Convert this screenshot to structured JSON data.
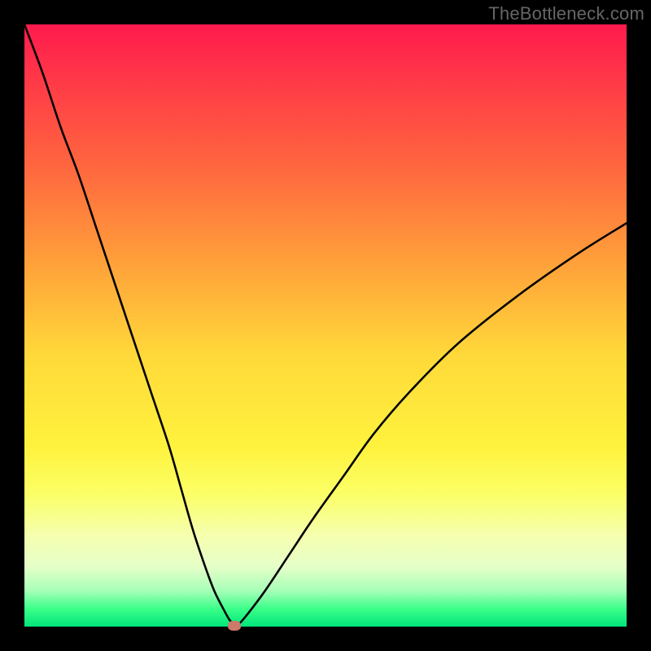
{
  "watermark": "TheBottleneck.com",
  "chart_data": {
    "type": "line",
    "title": "",
    "xlabel": "",
    "ylabel": "",
    "xlim": [
      0,
      100
    ],
    "ylim": [
      0,
      100
    ],
    "grid": false,
    "series": [
      {
        "name": "bottleneck-curve",
        "x": [
          0,
          3,
          6,
          9,
          12,
          15,
          18,
          21,
          24,
          26,
          28,
          30,
          31.5,
          33,
          34,
          34.8,
          35,
          35.5,
          37,
          40,
          44,
          48,
          53,
          58,
          64,
          72,
          82,
          92,
          100
        ],
        "y": [
          100,
          92,
          83,
          75,
          66,
          57,
          48,
          39,
          30,
          23,
          16,
          10,
          6,
          3,
          1.2,
          0.3,
          0.1,
          0.3,
          2,
          6,
          12,
          18,
          25,
          32,
          39,
          47,
          55,
          62,
          67
        ]
      }
    ],
    "marker": {
      "x": 34.8,
      "y": 0.1,
      "color": "#cc7a6b"
    },
    "gradient_description": "vertical red-to-green (high bottleneck to low bottleneck)"
  }
}
